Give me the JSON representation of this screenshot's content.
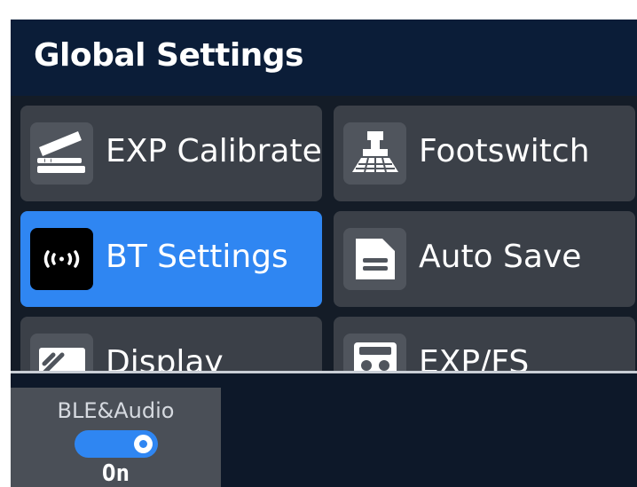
{
  "header": {
    "title": "Global Settings"
  },
  "menu": {
    "items": [
      {
        "label": "EXP Calibrate",
        "icon": "expression-pedal-icon",
        "selected": false
      },
      {
        "label": "Footswitch",
        "icon": "footswitch-icon",
        "selected": false
      },
      {
        "label": "BT Settings",
        "icon": "bluetooth-broadcast-icon",
        "selected": true
      },
      {
        "label": "Auto Save",
        "icon": "save-document-icon",
        "selected": false
      },
      {
        "label": "Display",
        "icon": "display-icon",
        "selected": false
      },
      {
        "label": "EXP/FS",
        "icon": "exp-fs-icon",
        "selected": false
      }
    ]
  },
  "param": {
    "label": "BLE&Audio",
    "value": "On",
    "enabled": true
  },
  "colors": {
    "accent": "#2f86f2",
    "header_bg": "#0b1d38",
    "tile_bg": "#3b4048",
    "screen_bg": "#0d1829"
  }
}
